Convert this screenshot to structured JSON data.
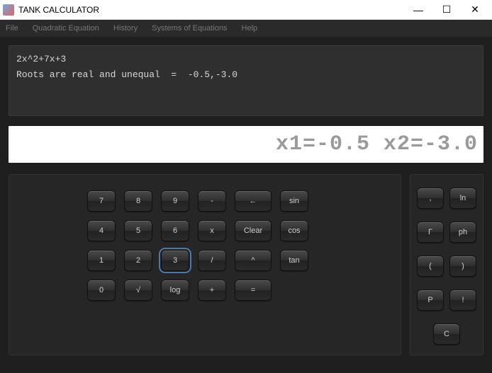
{
  "window": {
    "title": "TANK CALCULATOR",
    "min": "—",
    "max": "☐",
    "close": "✕"
  },
  "menu": {
    "file": "File",
    "quad": "Quadratic Equation",
    "history": "History",
    "systems": "Systems of Equations",
    "help": "Help"
  },
  "history": {
    "line1": "2x^2+7x+3",
    "line2": "Roots are real and unequal  =  -0.5,-3.0"
  },
  "display": "x1=-0.5 x2=-3.0",
  "keys": {
    "r1": [
      "7",
      "8",
      "9",
      "-",
      "←",
      "sin"
    ],
    "r2": [
      "4",
      "5",
      "6",
      "x",
      "Clear",
      "cos"
    ],
    "r3": [
      "1",
      "2",
      "3",
      "/",
      "^",
      "tan"
    ],
    "r4": [
      "0",
      "√",
      "log",
      "+",
      "="
    ]
  },
  "side": {
    "r1": [
      ",",
      "ln"
    ],
    "r2": [
      "Γ",
      "ph"
    ],
    "r3": [
      "(",
      ")"
    ],
    "r4": [
      "P",
      "!"
    ],
    "r5": [
      "C"
    ]
  }
}
